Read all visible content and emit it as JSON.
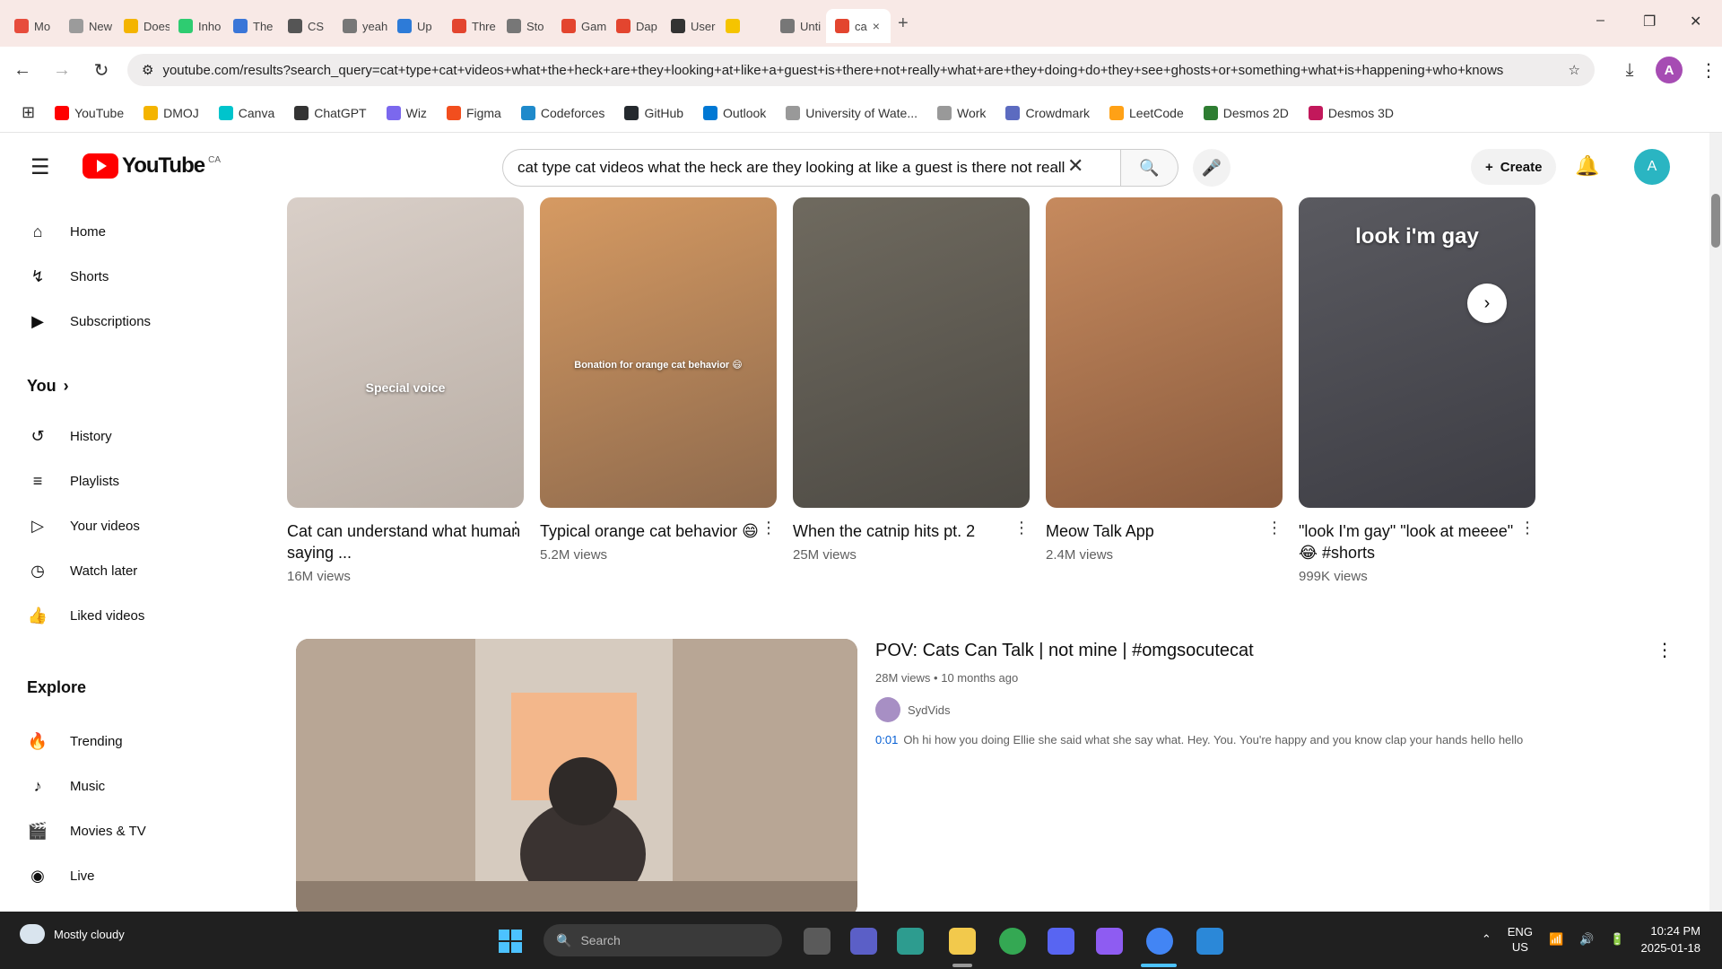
{
  "browser": {
    "tabs": [
      {
        "label": "Mo",
        "color": "#e74c3c"
      },
      {
        "label": "New",
        "color": "#9b9b9b"
      },
      {
        "label": "Does",
        "color": "#f4b400"
      },
      {
        "label": "Inho",
        "color": "#2ecc71"
      },
      {
        "label": "The",
        "color": "#3a76d8"
      },
      {
        "label": "CS",
        "color": "#555555"
      },
      {
        "label": "yeah",
        "color": "#777777"
      },
      {
        "label": "Up",
        "color": "#2d7bd8"
      },
      {
        "label": "Thre",
        "color": "#e3452f"
      },
      {
        "label": "Sto",
        "color": "#777777"
      },
      {
        "label": "Gam",
        "color": "#e3452f"
      },
      {
        "label": "Dap",
        "color": "#e3452f"
      },
      {
        "label": "User",
        "color": "#333333"
      },
      {
        "label": "",
        "color": "#f5c400"
      },
      {
        "label": "Unti",
        "color": "#777777"
      },
      {
        "label": "ca",
        "color": "#e3452f"
      }
    ],
    "active_tab_close": "×",
    "new_tab": "+",
    "window_controls": [
      "–",
      "❐",
      "✕"
    ],
    "url": "youtube.com/results?search_query=cat+type+cat+videos+what+the+heck+are+they+looking+at+like+a+guest+is+there+not+really+what+are+they+doing+do+they+see+ghosts+or+something+what+is+happening+who+knows",
    "profile_letter": "A",
    "bookmarks": [
      {
        "label": "YouTube",
        "color": "#ff0000"
      },
      {
        "label": "DMOJ",
        "color": "#f4b400"
      },
      {
        "label": "Canva",
        "color": "#00c4cc"
      },
      {
        "label": "ChatGPT",
        "color": "#333333"
      },
      {
        "label": "Wiz",
        "color": "#7b68ee"
      },
      {
        "label": "Figma",
        "color": "#f24e1e"
      },
      {
        "label": "Codeforces",
        "color": "#1f8acb"
      },
      {
        "label": "GitHub",
        "color": "#24292e"
      },
      {
        "label": "Outlook",
        "color": "#0078d4"
      },
      {
        "label": "University of Wate...",
        "color": "#999999"
      },
      {
        "label": "Work",
        "color": "#999999"
      },
      {
        "label": "Crowdmark",
        "color": "#5c6bc0"
      },
      {
        "label": "LeetCode",
        "color": "#ffa116"
      },
      {
        "label": "Desmos 2D",
        "color": "#2e7d32"
      },
      {
        "label": "Desmos 3D",
        "color": "#c2185b"
      }
    ]
  },
  "youtube": {
    "logo_text": "YouTube",
    "logo_region": "CA",
    "search_query": "cat type cat videos what the heck are they looking at like a guest is there not really",
    "create_label": "Create",
    "avatar_letter": "A",
    "sidebar": [
      {
        "label": "Home",
        "icon": "home-icon",
        "glyph": "⌂"
      },
      {
        "label": "Shorts",
        "icon": "shorts-icon",
        "glyph": "↯"
      },
      {
        "label": "Subscriptions",
        "icon": "subscriptions-icon",
        "glyph": "▶"
      },
      {
        "label": "You",
        "icon": "",
        "glyph": "",
        "header": true
      },
      {
        "label": "History",
        "icon": "history-icon",
        "glyph": "↺"
      },
      {
        "label": "Playlists",
        "icon": "playlists-icon",
        "glyph": "≡"
      },
      {
        "label": "Your videos",
        "icon": "your-videos-icon",
        "glyph": "▷"
      },
      {
        "label": "Watch later",
        "icon": "watch-later-icon",
        "glyph": "◷"
      },
      {
        "label": "Liked videos",
        "icon": "liked-icon",
        "glyph": "👍"
      },
      {
        "label": "Explore",
        "icon": "",
        "glyph": "",
        "header": true
      },
      {
        "label": "Trending",
        "icon": "trending-icon",
        "glyph": "🔥"
      },
      {
        "label": "Music",
        "icon": "music-icon",
        "glyph": "♪"
      },
      {
        "label": "Movies & TV",
        "icon": "movies-icon",
        "glyph": "🎬"
      },
      {
        "label": "Live",
        "icon": "live-icon",
        "glyph": "◉"
      },
      {
        "label": "Gaming",
        "icon": "gaming-icon",
        "glyph": "🎮"
      }
    ],
    "you_chevron": "›",
    "shorts": [
      {
        "title": "Cat can understand what human saying ...",
        "views": "16M views",
        "overlay": "Special voice",
        "bg1": "#d9cfc8",
        "bg2": "#b9aea5"
      },
      {
        "title": "Typical orange cat behavior 😄",
        "views": "5.2M views",
        "overlay": "Bonation for orange cat behavior 😄",
        "bg1": "#d69a62",
        "bg2": "#8e6a4d"
      },
      {
        "title": "When the catnip hits pt. 2",
        "views": "25M views",
        "overlay": "",
        "bg1": "#6f6a5f",
        "bg2": "#4d4a44"
      },
      {
        "title": "Meow Talk App",
        "views": "2.4M views",
        "overlay": "",
        "bg1": "#c68a5e",
        "bg2": "#8a5b3e"
      },
      {
        "title": "\"look I'm gay\" \"look at meeee\" 😂 #shorts",
        "views": "999K views",
        "overlay": "look i'm gay",
        "bg1": "#5a5a60",
        "bg2": "#3d3d44"
      }
    ],
    "video": {
      "title": "POV: Cats Can Talk | not mine | #omgsocutecat",
      "views": "28M views",
      "age": "10 months ago",
      "channel": "SydVids",
      "timestamp": "0:01",
      "description": "Oh hi how you doing Ellie she said what she say what. Hey. You. You're happy and you know clap your hands hello hello"
    }
  },
  "taskbar": {
    "weather": "Mostly cloudy",
    "search_placeholder": "Search",
    "lang_line1": "ENG",
    "lang_line2": "US",
    "time": "10:24 PM",
    "date": "2025-01-18"
  }
}
